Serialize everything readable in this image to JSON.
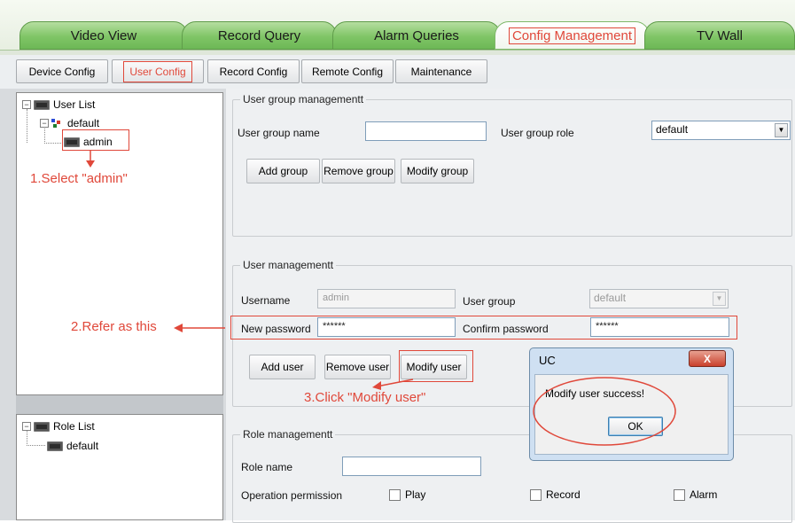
{
  "top_tabs": [
    {
      "label": "Video View",
      "active": false
    },
    {
      "label": "Record Query",
      "active": false
    },
    {
      "label": "Alarm Queries",
      "active": false
    },
    {
      "label": "Config Management",
      "active": true
    },
    {
      "label": "TV Wall",
      "active": false
    }
  ],
  "sub_tabs": [
    {
      "label": "Device Config",
      "selected": false
    },
    {
      "label": "User Config",
      "selected": true
    },
    {
      "label": "Record Config",
      "selected": false
    },
    {
      "label": "Remote Config",
      "selected": false
    },
    {
      "label": "Maintenance",
      "selected": false
    }
  ],
  "user_tree": {
    "root": "User List",
    "group": "default",
    "user": "admin"
  },
  "role_tree": {
    "root": "Role List",
    "item": "default"
  },
  "annotations": {
    "step1": "1.Select \"admin\"",
    "step2": "2.Refer as this",
    "step3": "3.Click \"Modify user\""
  },
  "user_group_mgmt": {
    "title": "User group managementt",
    "name_label": "User group name",
    "name_value": "",
    "role_label": "User group role",
    "role_value": "default",
    "add_btn": "Add group",
    "remove_btn": "Remove group",
    "modify_btn": "Modify group"
  },
  "user_mgmt": {
    "title": "User managementt",
    "username_label": "Username",
    "username_value": "admin",
    "group_label": "User group",
    "group_value": "default",
    "newpw_label": "New password",
    "newpw_value": "******",
    "confirmpw_label": "Confirm password",
    "confirmpw_value": "******",
    "add_btn": "Add user",
    "remove_btn": "Remove user",
    "modify_btn": "Modify user"
  },
  "role_mgmt": {
    "title": "Role managementt",
    "name_label": "Role name",
    "name_value": "",
    "perm_label": "Operation permission",
    "perms": [
      "Play",
      "Record",
      "Alarm"
    ]
  },
  "dialog": {
    "title": "UC",
    "close": "X",
    "message": "Modify user success!",
    "ok": "OK"
  },
  "colors": {
    "tab_green": "#7fc566",
    "annotation_red": "#e0483a",
    "panel_bg": "#eef0f2"
  }
}
